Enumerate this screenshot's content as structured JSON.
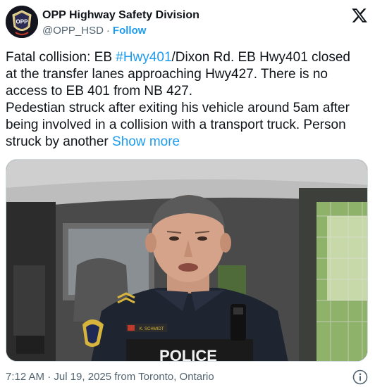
{
  "author": {
    "display_name": "OPP Highway Safety Division",
    "handle": "@OPP_HSD",
    "separator": "·",
    "follow_label": "Follow",
    "avatar_text": "OPP",
    "avatar_icon": "opp-badge-icon"
  },
  "brand": {
    "logo_icon": "x-logo-icon"
  },
  "tweet": {
    "lines": [
      {
        "before": "Fatal collision: EB ",
        "hashtag": "#Hwy401",
        "after": "/Dixon Rd. EB Hwy401 closed"
      },
      {
        "text": "at the transfer lanes approaching Hwy427.  There is no"
      },
      {
        "text": "access to EB 401 from NB 427."
      },
      {
        "text": "Pedestian struck after exiting his vehicle around 5am after"
      },
      {
        "text": "being involved in a collision with a transport truck. Person"
      },
      {
        "before": "struck by another ",
        "show_more": "Show more"
      }
    ]
  },
  "media": {
    "type": "video-frame",
    "subject": "officer-in-vehicle",
    "name_tag": "K. SCHMIDT",
    "vest_text": "POLICE"
  },
  "footer": {
    "timestamp": "7:12 AM · Jul 19, 2025 from Toronto, Ontario",
    "info_icon": "info-icon"
  },
  "colors": {
    "accent": "#1d9bf0",
    "text": "#0f1419",
    "muted": "#536471"
  }
}
